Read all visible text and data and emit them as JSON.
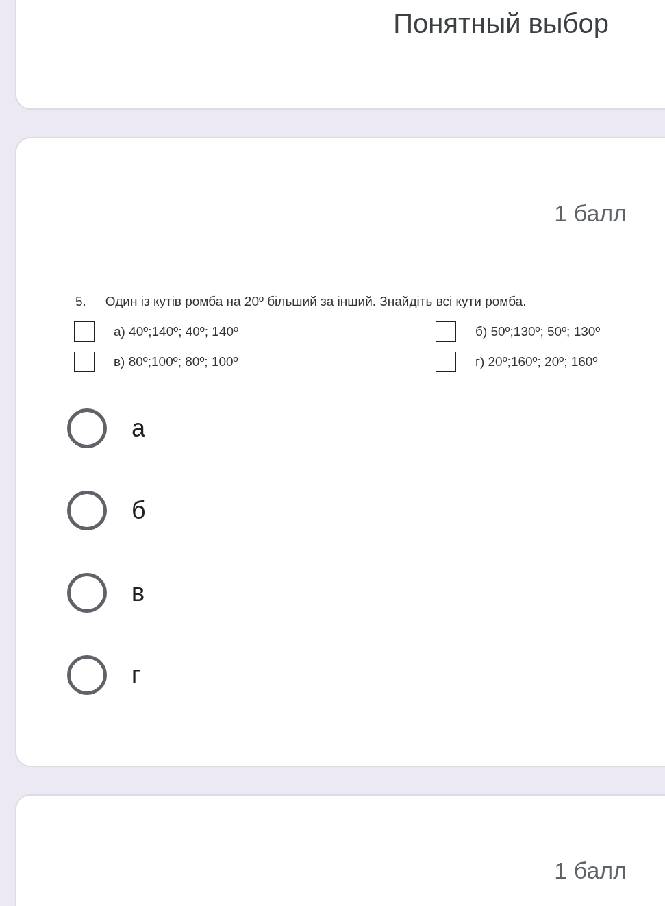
{
  "header_card": {
    "title": "Понятный выбор"
  },
  "questions": [
    {
      "points": "1 балл",
      "image": {
        "number": "5.",
        "text": "Один із кутів ромба на 20º більший за інший. Знайдіть всі кути ромба.",
        "options": [
          {
            "label": "а) 40º;140º; 40º; 140º",
            "checked": false
          },
          {
            "label": "б) 50º;130º; 50º; 130º",
            "checked": false
          },
          {
            "label": "в) 80º;100º; 80º; 100º",
            "checked": false
          },
          {
            "label": "г)  20º;160º; 20º; 160º",
            "checked": false
          }
        ]
      },
      "choices": [
        {
          "label": "а",
          "selected": false
        },
        {
          "label": "б",
          "selected": false
        },
        {
          "label": "в",
          "selected": false
        },
        {
          "label": "г",
          "selected": false
        }
      ]
    },
    {
      "points": "1 балл"
    }
  ]
}
